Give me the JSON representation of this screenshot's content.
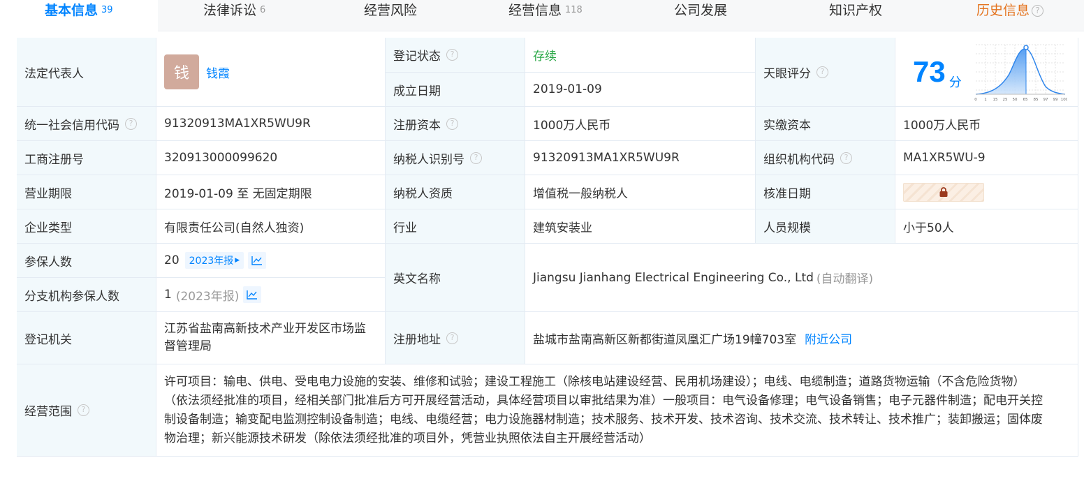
{
  "tabs": [
    {
      "label": "基本信息",
      "count": "39",
      "active": true
    },
    {
      "label": "法律诉讼",
      "count": "6"
    },
    {
      "label": "经营风险",
      "count": ""
    },
    {
      "label": "经营信息",
      "count": "118"
    },
    {
      "label": "公司发展",
      "count": ""
    },
    {
      "label": "知识产权",
      "count": ""
    },
    {
      "label": "历史信息",
      "count": "",
      "help": "?"
    }
  ],
  "info": {
    "legal_rep": {
      "label": "法定代表人",
      "avatar_char": "钱",
      "name": "钱霞"
    },
    "reg_status": {
      "label": "登记状态",
      "value": "存续"
    },
    "est_date": {
      "label": "成立日期",
      "value": "2019-01-09"
    },
    "score": {
      "label": "天眼评分",
      "value": "73",
      "unit": "分",
      "axis_ticks": [
        "0",
        "1",
        "15",
        "25",
        "50",
        "65",
        "85",
        "97",
        "99",
        "100"
      ]
    },
    "credit_code": {
      "label": "统一社会信用代码",
      "value": "91320913MA1XR5WU9R"
    },
    "reg_capital": {
      "label": "注册资本",
      "value": "1000万人民币"
    },
    "paid_capital": {
      "label": "实缴资本",
      "value": "1000万人民币"
    },
    "biz_reg_no": {
      "label": "工商注册号",
      "value": "320913000099620"
    },
    "taxpayer_id": {
      "label": "纳税人识别号",
      "value": "91320913MA1XR5WU9R"
    },
    "org_code": {
      "label": "组织机构代码",
      "value": "MA1XR5WU-9"
    },
    "biz_term": {
      "label": "营业期限",
      "value": "2019-01-09 至 无固定期限"
    },
    "taxpayer_qual": {
      "label": "纳税人资质",
      "value": "增值税一般纳税人"
    },
    "approve_date": {
      "label": "核准日期"
    },
    "company_type": {
      "label": "企业类型",
      "value": "有限责任公司(自然人独资)"
    },
    "industry": {
      "label": "行业",
      "value": "建筑安装业"
    },
    "staff_size": {
      "label": "人员规模",
      "value": "小于50人"
    },
    "insured": {
      "label": "参保人数",
      "value": "20",
      "report": "2023年报"
    },
    "branch_insured": {
      "label": "分支机构参保人数",
      "value": "1",
      "report": "(2023年报)"
    },
    "english_name": {
      "label": "英文名称",
      "value": "Jiangsu Jianhang Electrical Engineering Co., Ltd",
      "note": "(自动翻译)"
    },
    "reg_authority": {
      "label": "登记机关",
      "value_line1": "江苏省盐南高新技术产业开发区市场监",
      "value_line2": "督管理局"
    },
    "reg_address": {
      "label": "注册地址",
      "value": "盐城市盐南高新区新都街道凤凰汇广场19幢703室",
      "link": "附近公司"
    },
    "biz_scope": {
      "label": "经营范围",
      "lines": [
        "许可项目：输电、供电、受电电力设施的安装、维修和试验；建设工程施工（除核电站建设经营、民用机场建设）；电线、电缆制造；道路货物运输（不含危险货物）",
        "（依法须经批准的项目，经相关部门批准后方可开展经营活动，具体经营项目以审批结果为准）一般项目：电气设备修理；电气设备销售；电子元器件制造；配电开关控",
        "制设备制造；输变配电监测控制设备制造；电线、电缆经营；电力设施器材制造；技术服务、技术开发、技术咨询、技术交流、技术转让、技术推广；装卸搬运；固体废",
        "物治理；新兴能源技术研发（除依法须经批准的项目外，凭营业执照依法自主开展经营活动）"
      ]
    }
  },
  "colors": {
    "accent": "#0084ff",
    "status_green": "#28a745",
    "history_orange": "#e4731e",
    "label_bg": "#f2f9fc"
  },
  "icons": {
    "help": "question-circle-icon",
    "lock": "lock-icon",
    "trend": "trend-chart-icon",
    "caret": "caret-right-icon"
  }
}
